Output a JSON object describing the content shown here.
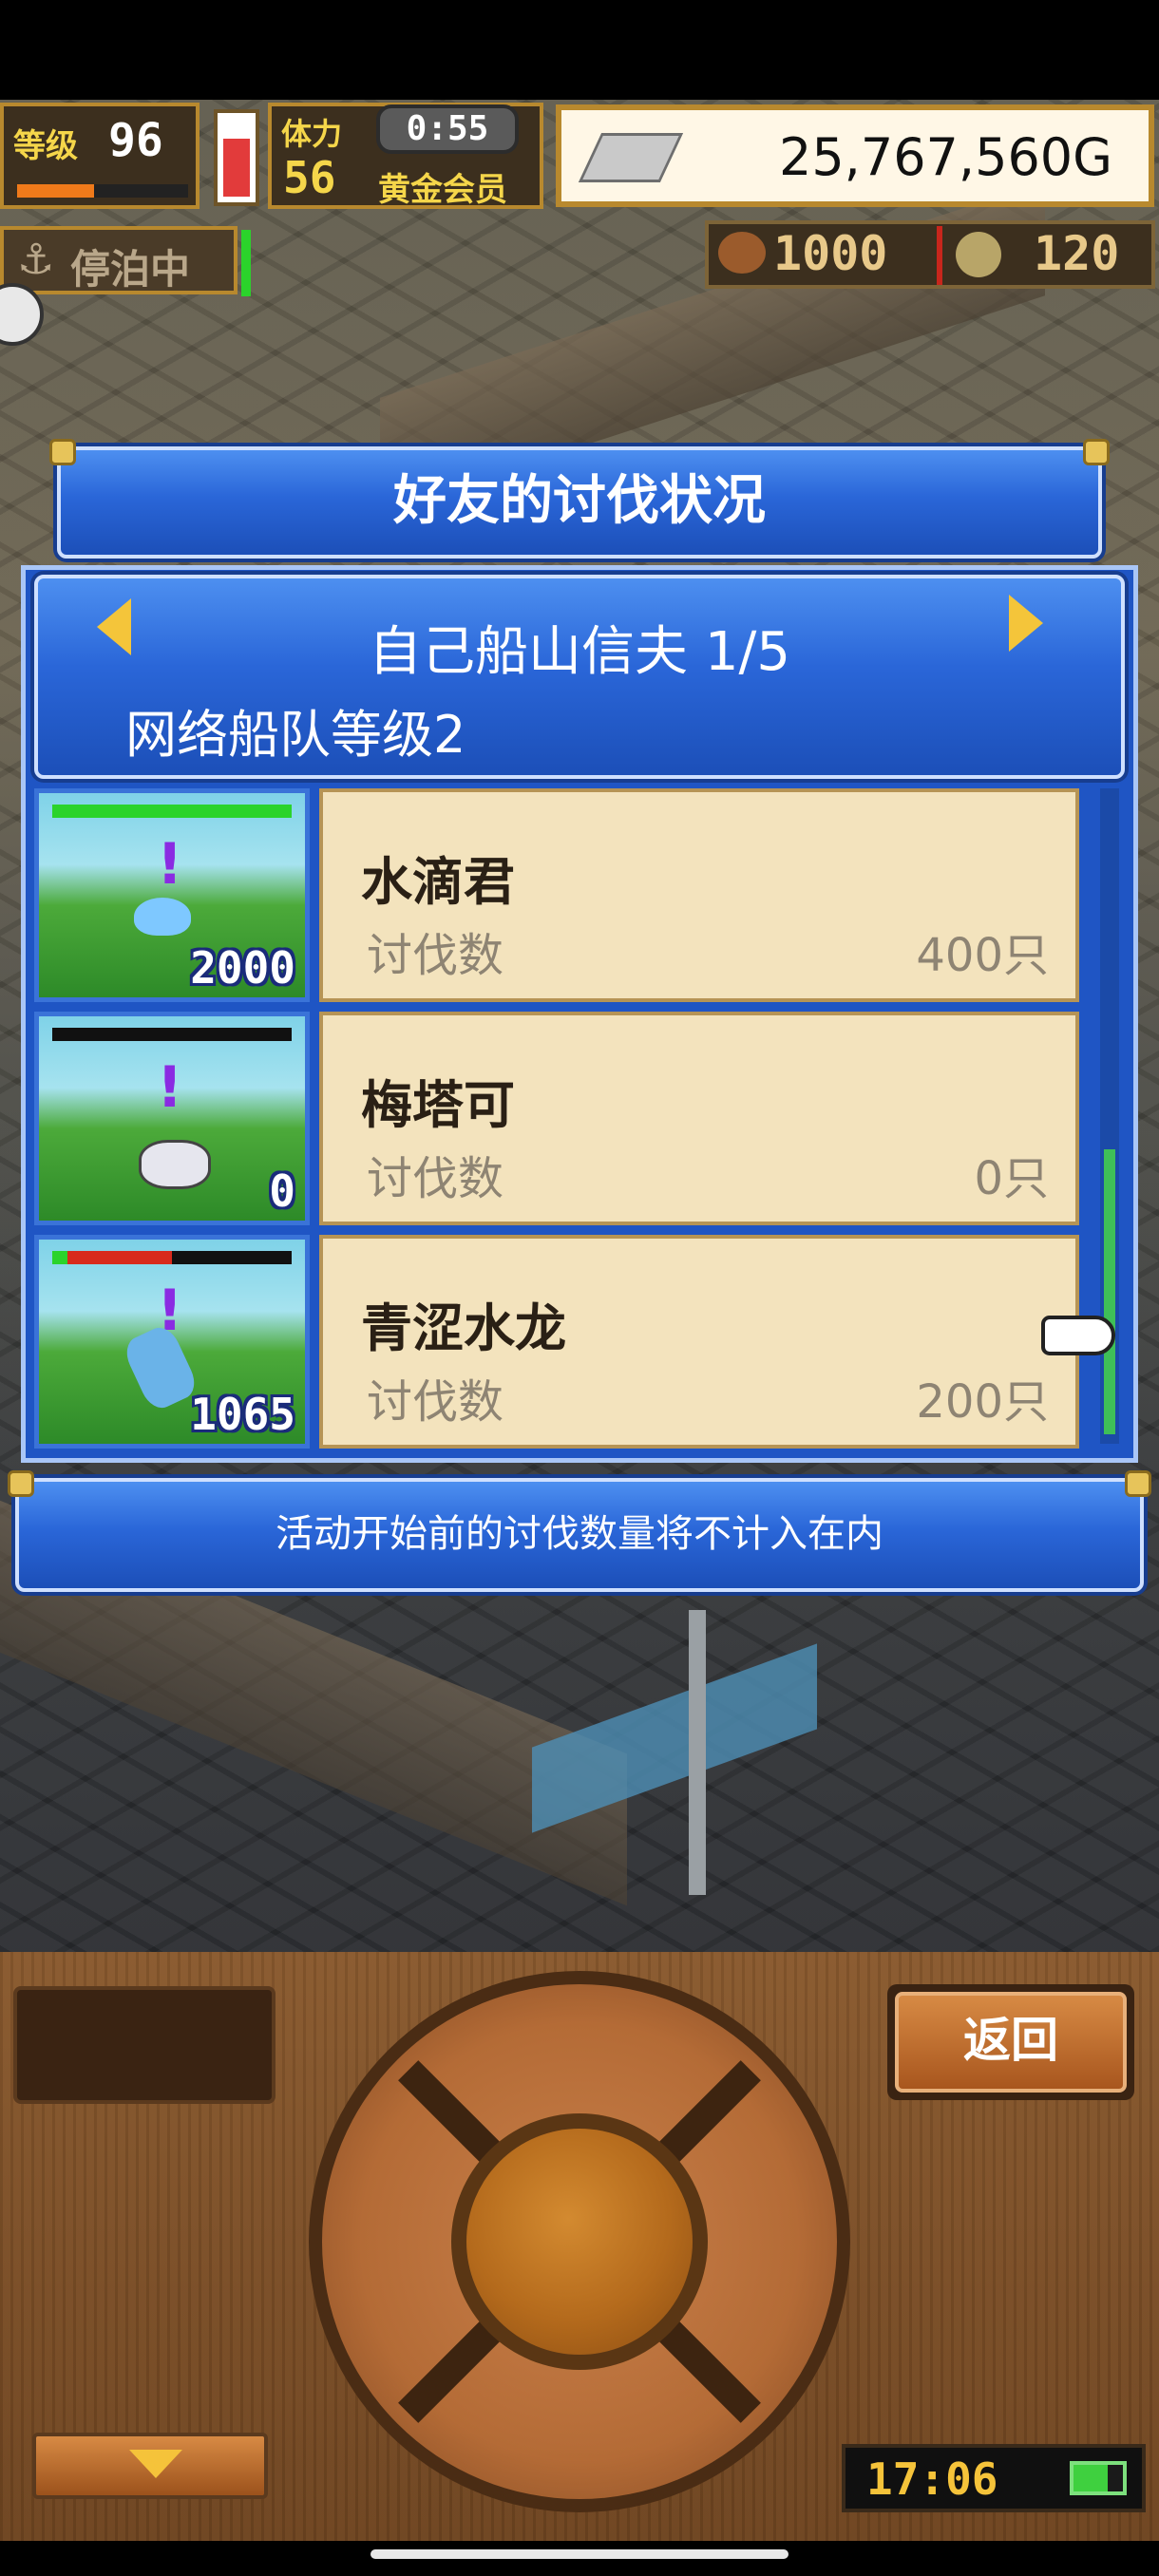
{
  "hud": {
    "level_label": "等级",
    "level": "96",
    "stamina_label": "体力",
    "stamina": "56",
    "timer": "0:55",
    "membership": "黄金会员",
    "gold": "25,767,560G",
    "anchor_status": "停泊中",
    "food": "1000",
    "coins": "120"
  },
  "dialog": {
    "title": "好友的讨伐状况",
    "friend": "自己船山信夫 1/5",
    "fleet_level": "网络船队等级2",
    "items": [
      {
        "name": "水滴君",
        "label": "讨伐数",
        "count": "400只",
        "hp": "2000",
        "hp_fill": 1.0
      },
      {
        "name": "梅塔可",
        "label": "讨伐数",
        "count": "0只",
        "hp": "0",
        "hp_fill": 0.0
      },
      {
        "name": "青涩水龙",
        "label": "讨伐数",
        "count": "200只",
        "hp": "1065",
        "hp_fill": 0.5
      }
    ],
    "notice": "活动开始前的讨伐数量将不计入在内"
  },
  "controls": {
    "back_label": "返回",
    "clock": "17:06"
  },
  "colors": {
    "hp_full": "#2bd32b",
    "hp_damage": "#d82a1c",
    "accent_gold": "#e7c45a",
    "dialog_blue": "#2a66d8"
  }
}
